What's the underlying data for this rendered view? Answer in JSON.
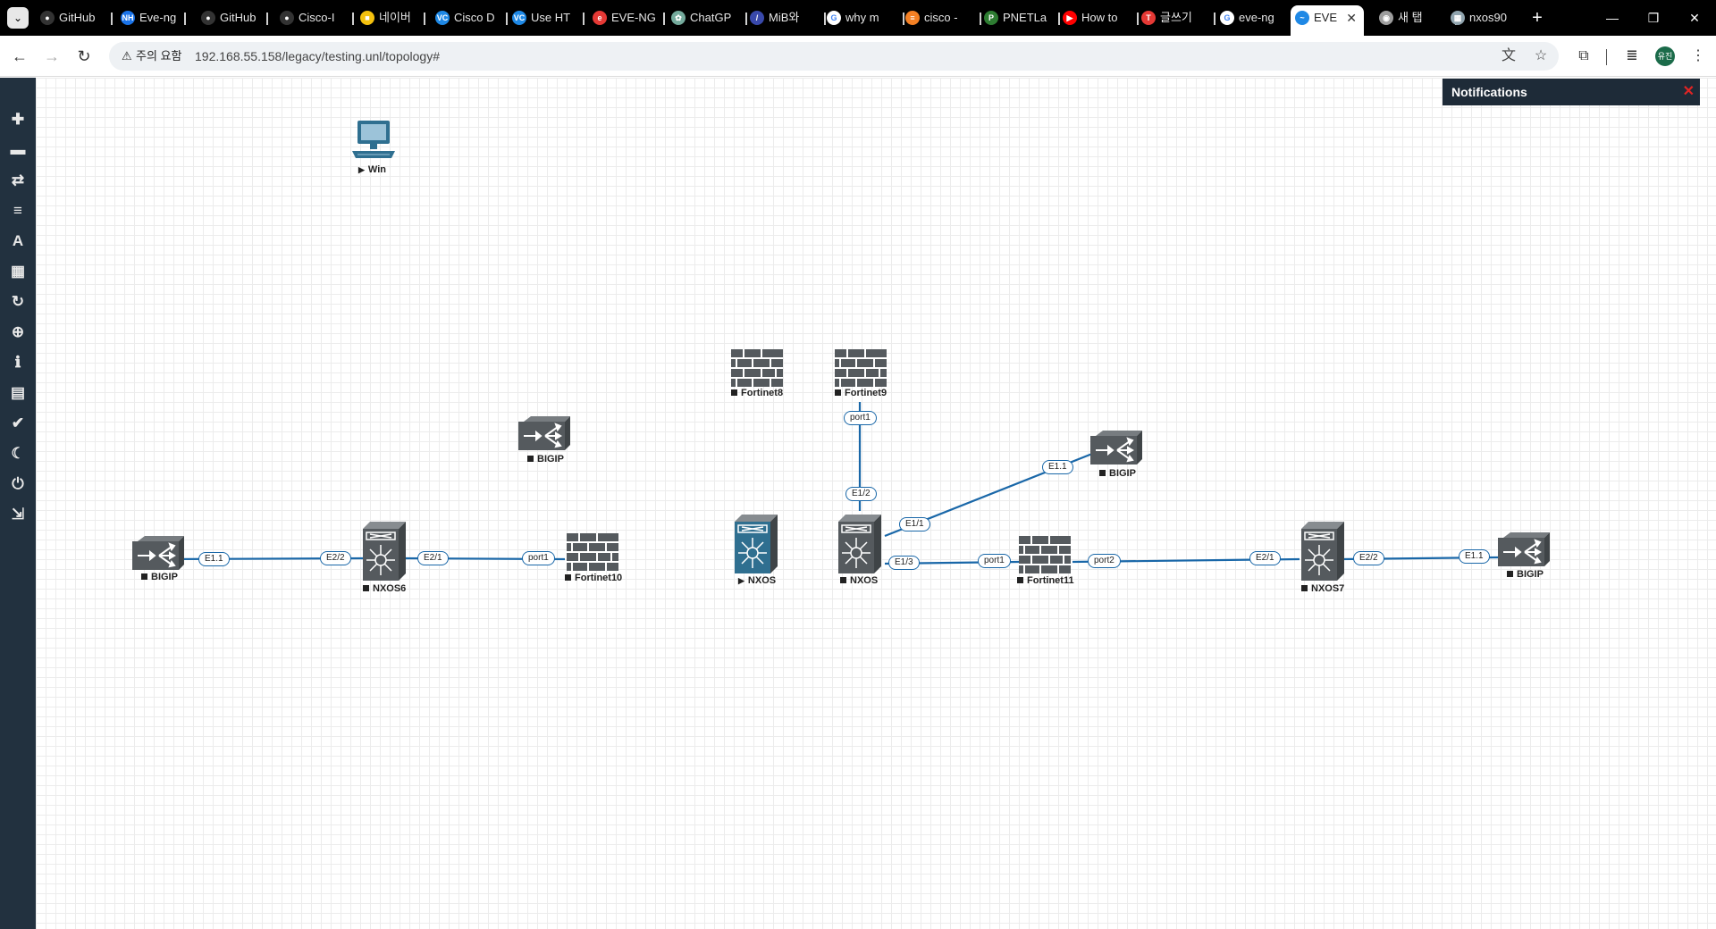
{
  "browser": {
    "tabs": [
      {
        "title": "GitHub",
        "icon": "github-icon",
        "color": "#333333",
        "glyph": "●"
      },
      {
        "title": "Eve-ng",
        "icon": "nh-icon",
        "color": "#1a73e8",
        "glyph": "NH"
      },
      {
        "title": "GitHub",
        "icon": "github-icon",
        "color": "#333333",
        "glyph": "●"
      },
      {
        "title": "Cisco-I",
        "icon": "github-icon",
        "color": "#333333",
        "glyph": "●"
      },
      {
        "title": "네이버",
        "icon": "naver-icon",
        "color": "#f4c10e",
        "glyph": "■"
      },
      {
        "title": "Cisco D",
        "icon": "vc-icon",
        "color": "#1e88e5",
        "glyph": "VC"
      },
      {
        "title": "Use HT",
        "icon": "vc-icon",
        "color": "#1e88e5",
        "glyph": "VC"
      },
      {
        "title": "EVE-NG",
        "icon": "eve-icon",
        "color": "#e53935",
        "glyph": "e"
      },
      {
        "title": "ChatGP",
        "icon": "chatgpt-icon",
        "color": "#74aa9c",
        "glyph": "✿"
      },
      {
        "title": "MiB와",
        "icon": "slash-icon",
        "color": "#3949ab",
        "glyph": "/"
      },
      {
        "title": "why m",
        "icon": "google-icon",
        "color": "#ffffff",
        "glyph": "G"
      },
      {
        "title": "cisco -",
        "icon": "stackoverflow-icon",
        "color": "#f48024",
        "glyph": "≡"
      },
      {
        "title": "PNETLa",
        "icon": "pnet-icon",
        "color": "#2e7d32",
        "glyph": "P"
      },
      {
        "title": "How to",
        "icon": "youtube-icon",
        "color": "#ff0000",
        "glyph": "▶"
      },
      {
        "title": "글쓰기",
        "icon": "tistory-icon",
        "color": "#e53935",
        "glyph": "T"
      },
      {
        "title": "eve-ng",
        "icon": "google-icon",
        "color": "#ffffff",
        "glyph": "G"
      },
      {
        "title": "EVE",
        "icon": "eve-logo-icon",
        "color": "#1e88e5",
        "glyph": "~",
        "active": true
      },
      {
        "title": "새 탭",
        "icon": "chrome-icon",
        "color": "#9e9e9e",
        "glyph": "◉"
      },
      {
        "title": "nxos90",
        "icon": "doc-icon",
        "color": "#90a4ae",
        "glyph": "▦"
      }
    ],
    "new_tab": "+",
    "address": {
      "security_label": "주의 요함",
      "url": "192.168.55.158/legacy/testing.unl/topology#"
    },
    "profile_initials": "유진"
  },
  "notifications": {
    "title": "Notifications",
    "close": "✕"
  },
  "sidebar_items": [
    {
      "name": "add-object",
      "glyph": "✚"
    },
    {
      "name": "nodes",
      "glyph": "▬"
    },
    {
      "name": "networks",
      "glyph": "⇄"
    },
    {
      "name": "startup-configs",
      "glyph": "≡"
    },
    {
      "name": "text-objects",
      "glyph": "A"
    },
    {
      "name": "pictures",
      "glyph": "▦"
    },
    {
      "name": "refresh",
      "glyph": "↻"
    },
    {
      "name": "zoom",
      "glyph": "⊕"
    },
    {
      "name": "lab-details",
      "glyph": "ℹ"
    },
    {
      "name": "workbook",
      "glyph": "▤"
    },
    {
      "name": "status",
      "glyph": "✔"
    },
    {
      "name": "dark-mode",
      "glyph": "☾"
    },
    {
      "name": "close-lab",
      "glyph": "⏻"
    },
    {
      "name": "logout",
      "glyph": "⇲"
    }
  ],
  "nodes": [
    {
      "id": "win",
      "label": "Win",
      "type": "pc",
      "state": "running"
    },
    {
      "id": "bigip1",
      "label": "BIGIP",
      "type": "lb",
      "state": "stopped"
    },
    {
      "id": "fortinet8",
      "label": "Fortinet8",
      "type": "firewall",
      "state": "stopped"
    },
    {
      "id": "fortinet9",
      "label": "Fortinet9",
      "type": "firewall",
      "state": "stopped"
    },
    {
      "id": "bigip2",
      "label": "BIGIP",
      "type": "lb",
      "state": "stopped"
    },
    {
      "id": "bigip3",
      "label": "BIGIP",
      "type": "lb",
      "state": "stopped"
    },
    {
      "id": "nxos6",
      "label": "NXOS6",
      "type": "switch",
      "state": "stopped"
    },
    {
      "id": "fortinet10",
      "label": "Fortinet10",
      "type": "firewall",
      "state": "stopped"
    },
    {
      "id": "nxos-blue",
      "label": "NXOS",
      "type": "switch-blue",
      "state": "running"
    },
    {
      "id": "nxos",
      "label": "NXOS",
      "type": "switch",
      "state": "stopped"
    },
    {
      "id": "fortinet11",
      "label": "Fortinet11",
      "type": "firewall",
      "state": "stopped"
    },
    {
      "id": "nxos7",
      "label": "NXOS7",
      "type": "switch",
      "state": "stopped"
    },
    {
      "id": "bigip4",
      "label": "BIGIP",
      "type": "lb",
      "state": "stopped"
    }
  ],
  "ports": {
    "p1": "E1.1",
    "p2": "E2/2",
    "p3": "E2/1",
    "p4": "port1",
    "p5": "port1",
    "p6": "E1/2",
    "p7": "E1/1",
    "p8": "E1.1",
    "p9": "E1/3",
    "p10": "port1",
    "p11": "port2",
    "p12": "E2/1",
    "p13": "E2/2",
    "p14": "E1.1"
  },
  "colors": {
    "link": "#1967a8",
    "device": "#555a5e",
    "device_blue": "#2f6f90",
    "sidebar": "#22313f"
  }
}
